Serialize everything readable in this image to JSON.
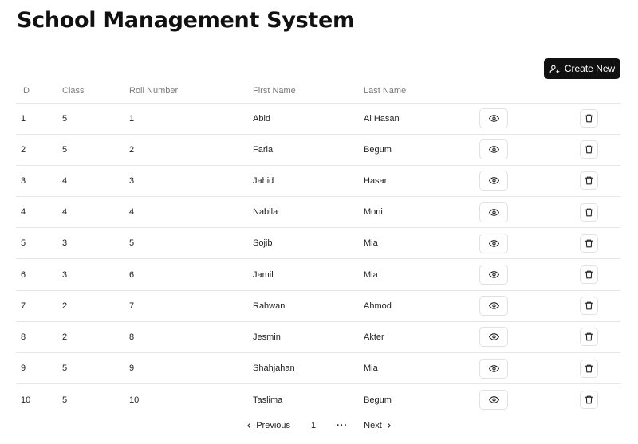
{
  "header": {
    "title": "School Management System"
  },
  "toolbar": {
    "create_label": "Create New"
  },
  "table": {
    "headers": {
      "id": "ID",
      "class": "Class",
      "roll": "Roll Number",
      "first": "First Name",
      "last": "Last Name"
    },
    "rows": [
      {
        "id": "1",
        "class": "5",
        "roll": "1",
        "first": "Abid",
        "last": "Al Hasan"
      },
      {
        "id": "2",
        "class": "5",
        "roll": "2",
        "first": "Faria",
        "last": "Begum"
      },
      {
        "id": "3",
        "class": "4",
        "roll": "3",
        "first": "Jahid",
        "last": "Hasan"
      },
      {
        "id": "4",
        "class": "4",
        "roll": "4",
        "first": "Nabila",
        "last": "Moni"
      },
      {
        "id": "5",
        "class": "3",
        "roll": "5",
        "first": "Sojib",
        "last": "Mia"
      },
      {
        "id": "6",
        "class": "3",
        "roll": "6",
        "first": "Jamil",
        "last": "Mia"
      },
      {
        "id": "7",
        "class": "2",
        "roll": "7",
        "first": "Rahwan",
        "last": "Ahmod"
      },
      {
        "id": "8",
        "class": "2",
        "roll": "8",
        "first": "Jesmin",
        "last": "Akter"
      },
      {
        "id": "9",
        "class": "5",
        "roll": "9",
        "first": "Shahjahan",
        "last": "Mia"
      },
      {
        "id": "10",
        "class": "5",
        "roll": "10",
        "first": "Taslima",
        "last": "Begum"
      }
    ]
  },
  "pagination": {
    "previous": "Previous",
    "current": "1",
    "ellipsis": "···",
    "next": "Next"
  },
  "icons": {
    "create": "user-plus-icon",
    "view": "eye-icon",
    "delete": "trash-icon",
    "previous": "chevron-left-icon",
    "next": "chevron-right-icon"
  },
  "colors": {
    "primary": "#111111",
    "border": "#e6e6e6",
    "muted": "#7a7a7a"
  }
}
